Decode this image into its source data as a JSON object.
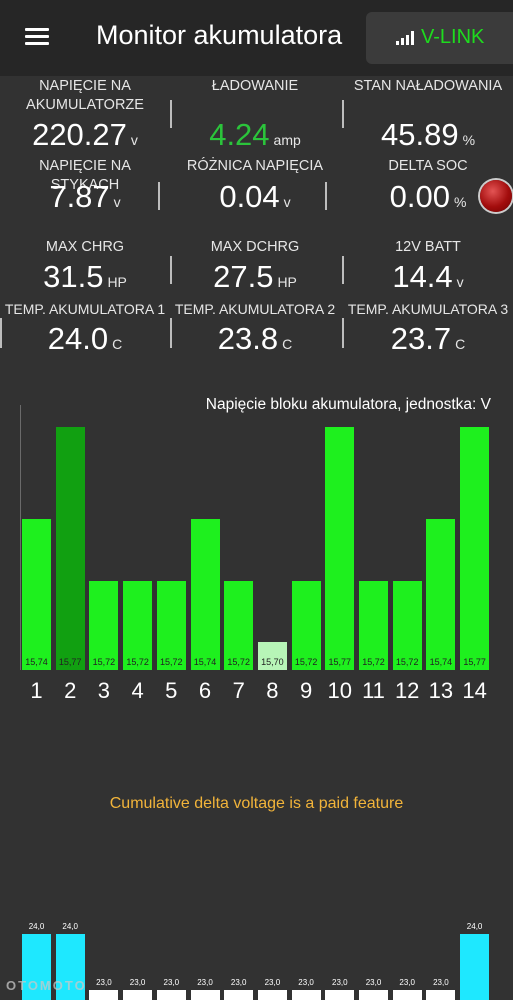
{
  "appbar": {
    "title": "Monitor akumulatora",
    "vlink_label": "V-LINK"
  },
  "stats": [
    {
      "id": "battery-voltage",
      "label": "NAPIĘCIE NA AKUMULATORZE",
      "value": "220.27",
      "unit": "v"
    },
    {
      "id": "charging",
      "label": "ŁADOWANIE",
      "value": "4.24",
      "unit": "amp",
      "highlight": "#2bc43b"
    },
    {
      "id": "state-of-charge",
      "label": "STAN NAŁADOWANIA",
      "value": "45.89",
      "unit": "%"
    },
    {
      "id": "contact-voltage",
      "label": "NAPIĘCIE NA STYKACH",
      "value": "7.87",
      "unit": "v"
    },
    {
      "id": "voltage-difference",
      "label": "RÓŻNICA NAPIĘCIA",
      "value": "0.04",
      "unit": "v"
    },
    {
      "id": "delta-soc",
      "label": "DELTA SOC",
      "value": "0.00",
      "unit": "%"
    },
    {
      "id": "max-charge",
      "label": "MAX CHRG",
      "value": "31.5",
      "unit": "HP"
    },
    {
      "id": "max-discharge",
      "label": "MAX DCHRG",
      "value": "27.5",
      "unit": "HP"
    },
    {
      "id": "12v-battery",
      "label": "12V BATT",
      "value": "14.4",
      "unit": "v"
    },
    {
      "id": "temp-1",
      "label": "TEMP. AKUMULATORA 1",
      "value": "24.0",
      "unit": "C"
    },
    {
      "id": "temp-2",
      "label": "TEMP. AKUMULATORA 2",
      "value": "23.8",
      "unit": "C"
    },
    {
      "id": "temp-3",
      "label": "TEMP. AKUMULATORA 3",
      "value": "23.7",
      "unit": "C"
    }
  ],
  "chart_data": [
    {
      "type": "bar",
      "title": "Napięcie bloku akumulatora, jednostka: V",
      "categories": [
        "1",
        "2",
        "3",
        "4",
        "5",
        "6",
        "7",
        "8",
        "9",
        "10",
        "11",
        "12",
        "13",
        "14"
      ],
      "values": [
        15.74,
        15.77,
        15.72,
        15.72,
        15.72,
        15.74,
        15.72,
        15.7,
        15.72,
        15.77,
        15.72,
        15.72,
        15.74,
        15.77
      ],
      "value_labels": [
        "15,74",
        "15,77",
        "15,72",
        "15,72",
        "15,72",
        "15,74",
        "15,72",
        "15,70",
        "15,72",
        "15,77",
        "15,72",
        "15,72",
        "15,74",
        "15,77"
      ],
      "ylim": [
        15.7,
        15.77
      ],
      "colors": {
        "default": "#1ef01e",
        "max_first": "#11a011",
        "min": "#b7f5b7"
      },
      "grid": false
    },
    {
      "type": "bar",
      "values": [
        24.0,
        24.0,
        23.0,
        23.0,
        23.0,
        23.0,
        23.0,
        23.0,
        23.0,
        23.0,
        23.0,
        23.0,
        23.0,
        24.0
      ],
      "value_labels": [
        "24,0",
        "24,0",
        "23,0",
        "23,0",
        "23,0",
        "23,0",
        "23,0",
        "23,0",
        "23,0",
        "23,0",
        "23,0",
        "23,0",
        "23,0",
        "24,0"
      ],
      "colors": {
        "high": "#1ee8ff",
        "low": "#ffffff"
      }
    }
  ],
  "paid_notice": "Cumulative delta voltage is a paid feature",
  "watermark": "OTOMOTO"
}
